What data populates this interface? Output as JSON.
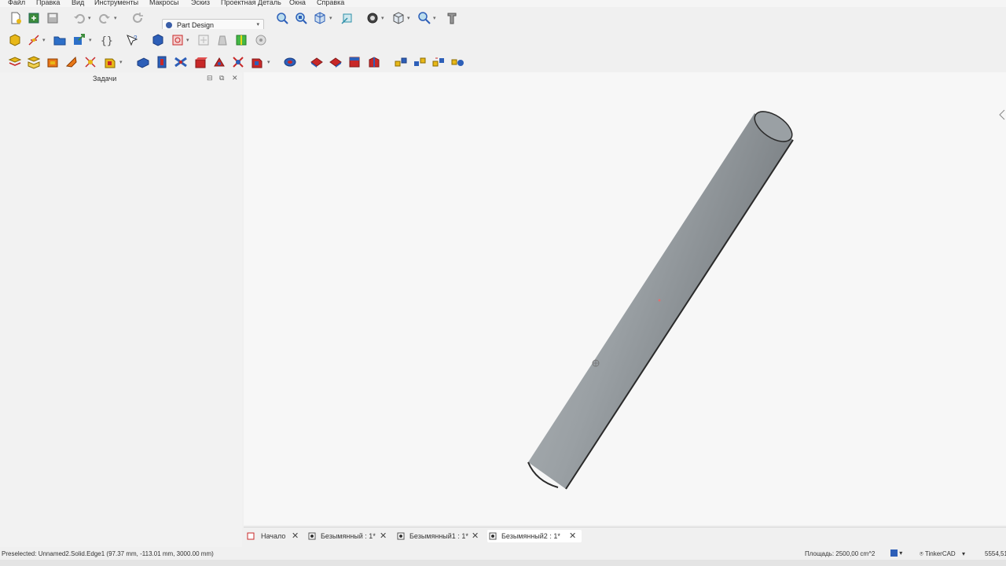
{
  "menu": [
    "Файл",
    "Правка",
    "Вид",
    "Инструменты",
    "Макросы",
    "Эскиз",
    "Проектная Деталь",
    "Окна",
    "Справка"
  ],
  "workbench": {
    "selected": "Part Design"
  },
  "toolbar_row1_icons": [
    "new-document-icon",
    "open-document-icon",
    "save-document-icon",
    "undo-icon",
    "redo-icon",
    "refresh-icon",
    "fit-all-icon",
    "fit-selection-icon",
    "isometric-view-icon",
    "look-at-icon",
    "draw-style-icon",
    "standard-views-icon",
    "measure-icon",
    "macro-icon"
  ],
  "toolbar_row2_icons": [
    "part-container-icon",
    "sketch-icon",
    "group-icon",
    "link-icon",
    "expression-icon",
    "whats-this-icon",
    "body-icon",
    "create-sketch-icon",
    "validate-sketch-icon",
    "clone-icon",
    "shape-binder-icon",
    "sub-shape-binder-icon"
  ],
  "toolbar_row3_icons": [
    "datum-point-icon",
    "datum-line-icon",
    "datum-plane-icon",
    "local-cs-icon",
    "datum-shape-icon",
    "additive-primitive-icon",
    "pad-icon",
    "revolution-icon",
    "loft-icon",
    "pipe-icon",
    "helix-icon",
    "subtractive-primitive-icon",
    "boolean-icon",
    "pocket-icon",
    "hole-icon",
    "groove-icon",
    "subtractive-loft-icon",
    "mirrored-icon",
    "linear-pattern-icon",
    "polar-pattern-icon",
    "multi-transform-icon"
  ],
  "panel": {
    "title": "Задачи"
  },
  "tabs": [
    {
      "label": "Начало",
      "active": false
    },
    {
      "label": "Безымянный : 1*",
      "active": false
    },
    {
      "label": "Безымянный1 : 1*",
      "active": false
    },
    {
      "label": "Безымянный2 : 1*",
      "active": true
    }
  ],
  "status": {
    "preselected": "Preselected: Unnamed2.Solid.Edge1 (97.37 mm, -113.01 mm, 3000.00 mm)",
    "area": "Площадь: 2500,00 cm^2",
    "navigation": "TinkerCAD",
    "coord": "5554,51"
  },
  "colors": {
    "cylinder": "#9aa0a4",
    "accent_blue": "#2d5fb8",
    "yellow": "#e8b818",
    "red": "#c82828"
  }
}
